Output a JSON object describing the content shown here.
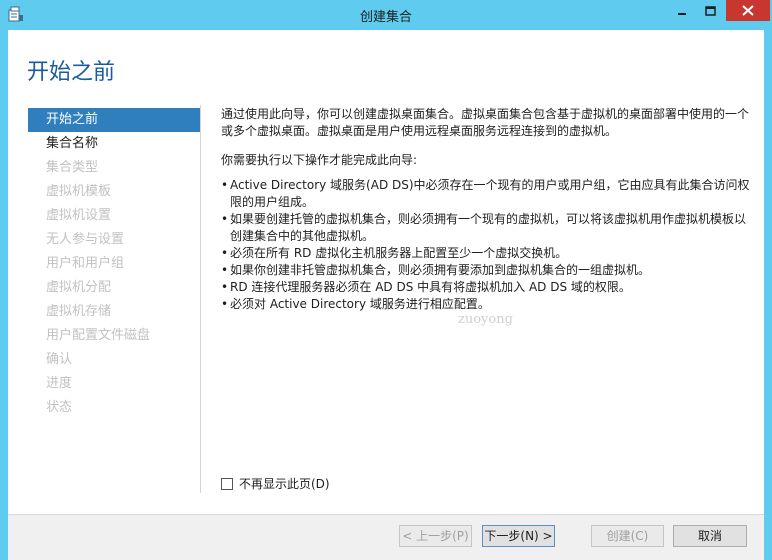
{
  "window": {
    "title": "创建集合",
    "controls": {
      "minimize_icon": "minimize-icon",
      "maximize_icon": "maximize-icon",
      "close_icon": "close-icon"
    },
    "titlebar_color": "#5ecbef",
    "close_color": "#c7372f"
  },
  "page": {
    "title": "开始之前"
  },
  "nav": {
    "items": [
      {
        "label": "开始之前",
        "state": "active"
      },
      {
        "label": "集合名称",
        "state": "enabled"
      },
      {
        "label": "集合类型",
        "state": "disabled"
      },
      {
        "label": "虚拟机模板",
        "state": "disabled"
      },
      {
        "label": "虚拟机设置",
        "state": "disabled"
      },
      {
        "label": "无人参与设置",
        "state": "disabled"
      },
      {
        "label": "用户和用户组",
        "state": "disabled"
      },
      {
        "label": "虚拟机分配",
        "state": "disabled"
      },
      {
        "label": "虚拟机存储",
        "state": "disabled"
      },
      {
        "label": "用户配置文件磁盘",
        "state": "disabled"
      },
      {
        "label": "确认",
        "state": "disabled"
      },
      {
        "label": "进度",
        "state": "disabled"
      },
      {
        "label": "状态",
        "state": "disabled"
      }
    ],
    "active_color": "#2f7fbf"
  },
  "main": {
    "intro": "通过使用此向导，你可以创建虚拟桌面集合。虚拟桌面集合包含基于虚拟机的桌面部署中使用的一个或多个虚拟桌面。虚拟桌面是用户使用远程桌面服务远程连接到的虚拟机。",
    "requirements_heading": "你需要执行以下操作才能完成此向导:",
    "requirements": [
      "Active Directory 域服务(AD DS)中必须存在一个现有的用户或用户组，它由应具有此集合访问权限的用户组成。",
      "如果要创建托管的虚拟机集合，则必须拥有一个现有的虚拟机，可以将该虚拟机用作虚拟机模板以创建集合中的其他虚拟机。",
      "必须在所有 RD 虚拟化主机服务器上配置至少一个虚拟交换机。",
      "如果你创建非托管虚拟机集合，则必须拥有要添加到虚拟机集合的一组虚拟机。",
      "RD 连接代理服务器必须在 AD DS 中具有将虚拟机加入 AD DS 域的权限。",
      "必须对 Active Directory 域服务进行相应配置。"
    ],
    "dont_show_label": "不再显示此页(D)",
    "dont_show_checked": false
  },
  "watermark": "zuoyong",
  "footer": {
    "prev_label": "< 上一步(P)",
    "next_label": "下一步(N) >",
    "create_label": "创建(C)",
    "cancel_label": "取消"
  }
}
